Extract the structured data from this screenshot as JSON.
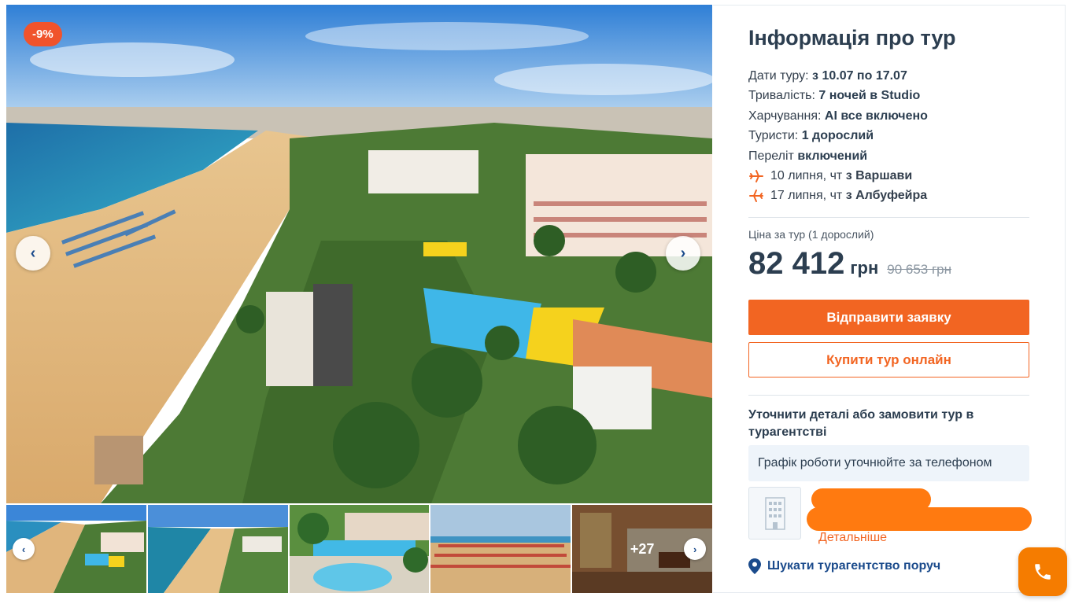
{
  "gallery": {
    "discount_badge": "-9%",
    "prev_icon": "chevron-left-icon",
    "next_icon": "chevron-right-icon",
    "thumbs_more_label": "+27"
  },
  "info": {
    "title": "Інформація про тур",
    "dates_label": "Дати туру:",
    "dates_value": "з 10.07 по 17.07",
    "duration_label": "Тривалість:",
    "duration_value": "7 ночей в Studio",
    "meals_label": "Харчування:",
    "meals_value": "AI все включено",
    "tourists_label": "Туристи:",
    "tourists_value": "1 дорослий",
    "flight_label": "Переліт",
    "flight_value": "включений",
    "flight_out_date": "10 липня, чт",
    "flight_out_from": "з Варшави",
    "flight_back_date": "17 липня, чт",
    "flight_back_from": "з Албуфейра"
  },
  "price": {
    "caption": "Ціна за тур (1 дорослий)",
    "value": "82 412",
    "currency": "грн",
    "old": "90 653 грн"
  },
  "actions": {
    "send_request": "Відправити заявку",
    "buy_online": "Купити тур онлайн"
  },
  "agency": {
    "prompt": "Уточнити деталі або замовити тур в турагентстві",
    "hours": "Графік роботи уточнюйте за телефоном",
    "details_link": "Детальніше",
    "find_nearby": "Шукати турагентство поруч"
  },
  "colors": {
    "accent": "#f26522",
    "discount": "#f0532c",
    "link": "#1b4b8c",
    "call_button": "#f57c00"
  }
}
